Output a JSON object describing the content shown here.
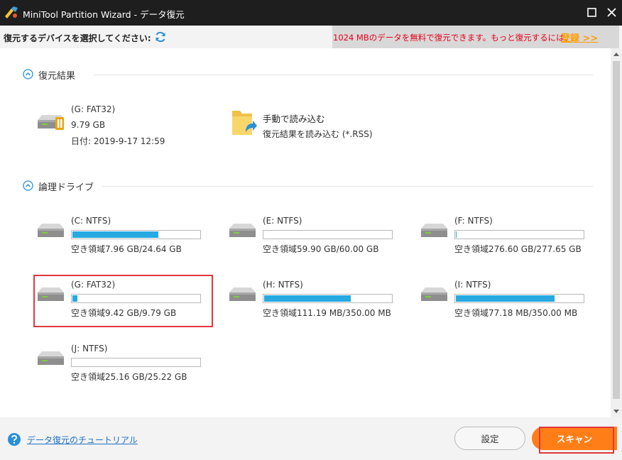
{
  "window": {
    "title": "MiniTool Partition Wizard - データ復元",
    "logo_icon": "partition-wizard-logo-icon",
    "maximize_icon": "maximize-icon",
    "close_icon": "close-icon"
  },
  "header": {
    "prompt": "復元するデバイスを選択してください:",
    "refresh_icon": "refresh-icon",
    "promo_text": "1024 MBのデータを無料で復元できます。もっと復元するには、",
    "register_link": "登録 >>"
  },
  "recovery_results": {
    "title": "復元結果",
    "collapse_icon": "chevron-up-icon",
    "result": {
      "name": "(G: FAT32)",
      "size": "9.79 GB",
      "date": "日付: 2019-9-17 12:59",
      "icon": "recovered-drive-icon"
    },
    "manual_load": {
      "title": "手動で読み込む",
      "description": "復元結果を読み込む (*.RSS)",
      "icon": "folder-import-icon"
    }
  },
  "logical_drives": {
    "title": "論理ドライブ",
    "collapse_icon": "chevron-up-icon",
    "drives": [
      {
        "name": "(C: NTFS)",
        "space": "空き領域7.96 GB/24.64 GB",
        "used_fraction": 0.677
      },
      {
        "name": "(E: NTFS)",
        "space": "空き領域59.90 GB/60.00 GB",
        "used_fraction": 0.002
      },
      {
        "name": "(F: NTFS)",
        "space": "空き領域276.60 GB/277.65 GB",
        "used_fraction": 0.004
      },
      {
        "name": "(G: FAT32)",
        "space": "空き領域9.42 GB/9.79 GB",
        "used_fraction": 0.038,
        "selected": true
      },
      {
        "name": "(H: NTFS)",
        "space": "空き領域111.19 MB/350.00 MB",
        "used_fraction": 0.682
      },
      {
        "name": "(I: NTFS)",
        "space": "空き領域77.18 MB/350.00 MB",
        "used_fraction": 0.779
      },
      {
        "name": "(J: NTFS)",
        "space": "空き領域25.16 GB/25.22 GB",
        "used_fraction": 0.002
      }
    ]
  },
  "footer": {
    "help_icon": "help-icon",
    "tutorial_link": "データ復元のチュートリアル",
    "settings_button": "設定",
    "scan_button": "スキャン"
  },
  "colors": {
    "titlebar": "#1e1e1e",
    "usage_bar": "#27a9e1",
    "promo_text": "#e4001b",
    "register_link": "#ff9d00",
    "scan_button": "#ff7e18",
    "selection_outline": "#e0383e",
    "link": "#1f72c4"
  }
}
